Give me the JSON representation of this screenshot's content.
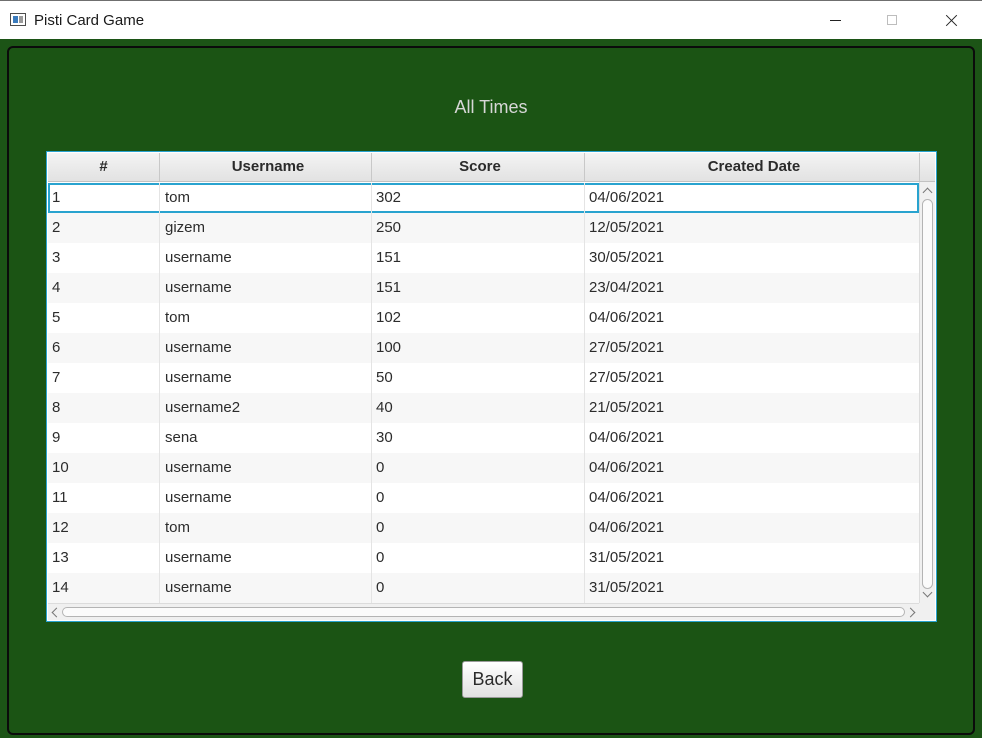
{
  "window": {
    "title": "Pisti Card Game",
    "icon": "app-icon",
    "controls": [
      "minimize-icon",
      "maximize-icon",
      "close-icon"
    ]
  },
  "page": {
    "heading": "All Times",
    "back_label": "Back",
    "colors": {
      "background": "#1c5416",
      "accent": "#29a3cf",
      "heading_text": "#d7d7d7"
    }
  },
  "table": {
    "columns": [
      "#",
      "Username",
      "Score",
      "Created Date"
    ],
    "selected_row": 0,
    "rows": [
      [
        "1",
        "tom",
        "302",
        "04/06/2021"
      ],
      [
        "2",
        "gizem",
        "250",
        "12/05/2021"
      ],
      [
        "3",
        "username",
        "151",
        "30/05/2021"
      ],
      [
        "4",
        "username",
        "151",
        "23/04/2021"
      ],
      [
        "5",
        "tom",
        "102",
        "04/06/2021"
      ],
      [
        "6",
        "username",
        "100",
        "27/05/2021"
      ],
      [
        "7",
        "username",
        "50",
        "27/05/2021"
      ],
      [
        "8",
        "username2",
        "40",
        "21/05/2021"
      ],
      [
        "9",
        "sena",
        "30",
        "04/06/2021"
      ],
      [
        "10",
        "username",
        "0",
        "04/06/2021"
      ],
      [
        "11",
        "username",
        "0",
        "04/06/2021"
      ],
      [
        "12",
        "tom",
        "0",
        "04/06/2021"
      ],
      [
        "13",
        "username",
        "0",
        "31/05/2021"
      ],
      [
        "14",
        "username",
        "0",
        "31/05/2021"
      ]
    ]
  }
}
